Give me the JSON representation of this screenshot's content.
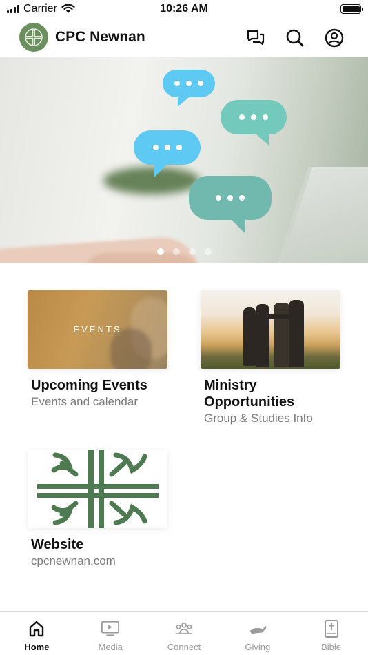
{
  "status_bar": {
    "carrier": "Carrier",
    "time": "10:26 AM"
  },
  "header": {
    "title": "CPC Newnan"
  },
  "hero": {
    "slide_count": 4,
    "active_slide": 1
  },
  "cards": [
    {
      "title": "Upcoming Events",
      "subtitle": "Events and calendar",
      "thumb_text": "EVENTS"
    },
    {
      "title": "Ministry Opportunities",
      "subtitle": "Group & Studies Info"
    },
    {
      "title": "Website",
      "subtitle": "cpcnewnan.com"
    }
  ],
  "tabs": [
    {
      "label": "Home",
      "icon": "home-icon",
      "active": true
    },
    {
      "label": "Media",
      "icon": "tv-icon",
      "active": false
    },
    {
      "label": "Connect",
      "icon": "people-icon",
      "active": false
    },
    {
      "label": "Giving",
      "icon": "giving-hand-icon",
      "active": false
    },
    {
      "label": "Bible",
      "icon": "bible-icon",
      "active": false
    }
  ],
  "colors": {
    "brand_green": "#6c8f5f",
    "cross_green": "#4e7a52",
    "bubble_blue": "#5ec9f3",
    "bubble_teal": "#74c9bd"
  }
}
